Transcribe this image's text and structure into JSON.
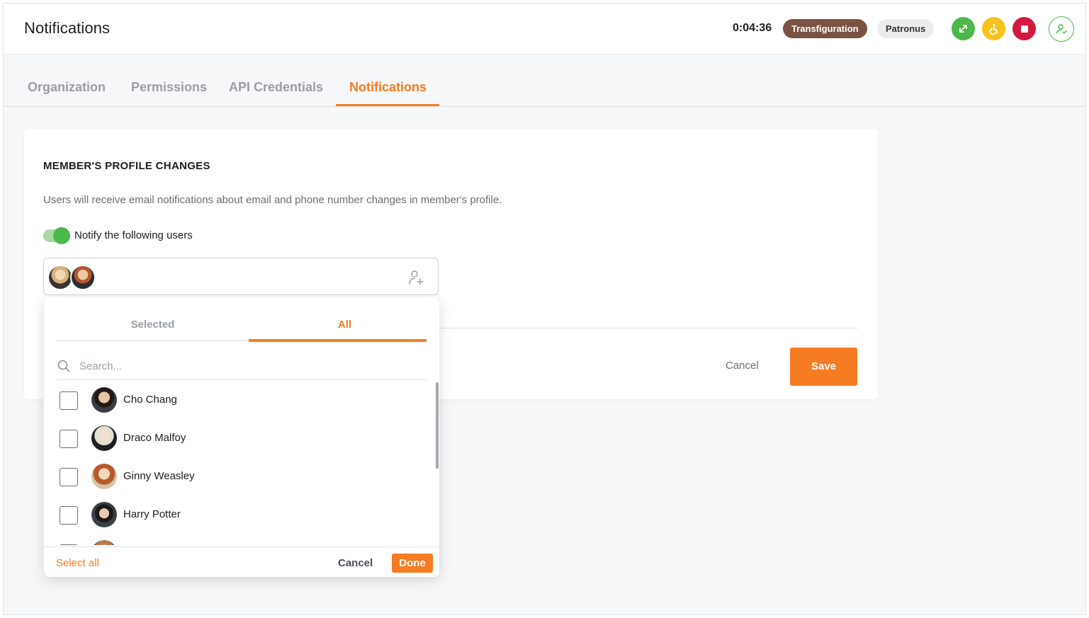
{
  "header": {
    "title": "Notifications",
    "timer": "0:04:36",
    "tag_primary": "Transfiguration",
    "tag_secondary": "Patronus",
    "icons": [
      "transfer-icon",
      "accessibility-icon",
      "stop-icon",
      "user-check-icon"
    ],
    "colors": {
      "green": "#4cb84a",
      "yellow": "#f7c21d",
      "red": "#d2183f",
      "brown": "#7a5242"
    }
  },
  "tabs": [
    {
      "label": "Organization",
      "active": false
    },
    {
      "label": "Permissions",
      "active": false
    },
    {
      "label": "API Credentials",
      "active": false
    },
    {
      "label": "Notifications",
      "active": true
    }
  ],
  "accent_color": "#f57c22",
  "card": {
    "title": "MEMBER'S PROFILE CHANGES",
    "description": "Users will receive email notifications about email and phone number changes in member's profile.",
    "toggle_label": "Notify the following users",
    "toggle_on": true,
    "cancel_label": "Cancel",
    "save_label": "Save"
  },
  "dropdown": {
    "tab_selected": "Selected",
    "tab_all": "All",
    "active_tab": "All",
    "search_placeholder": "Search...",
    "users": [
      {
        "name": "Cho Chang",
        "checked": false
      },
      {
        "name": "Draco Malfoy",
        "checked": false
      },
      {
        "name": "Ginny Weasley",
        "checked": false
      },
      {
        "name": "Harry Potter",
        "checked": false
      }
    ],
    "select_all_label": "Select all",
    "cancel_label": "Cancel",
    "done_label": "Done"
  }
}
